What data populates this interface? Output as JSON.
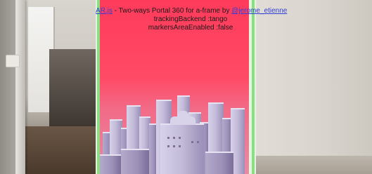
{
  "header": {
    "link_arjs": "AR.js",
    "title_middle": " - Two-ways Portal 360 for a-frame by ",
    "link_author": "@jerome_etienne",
    "line_tracking": "trackingBackend :tango",
    "line_markers": "markersAreaEnabled :false"
  },
  "colors": {
    "portal_sky": "#ff3b5b",
    "portal_border": "#8fdc86",
    "buildings": "#c2bad8",
    "link": "#2f3fd6"
  }
}
